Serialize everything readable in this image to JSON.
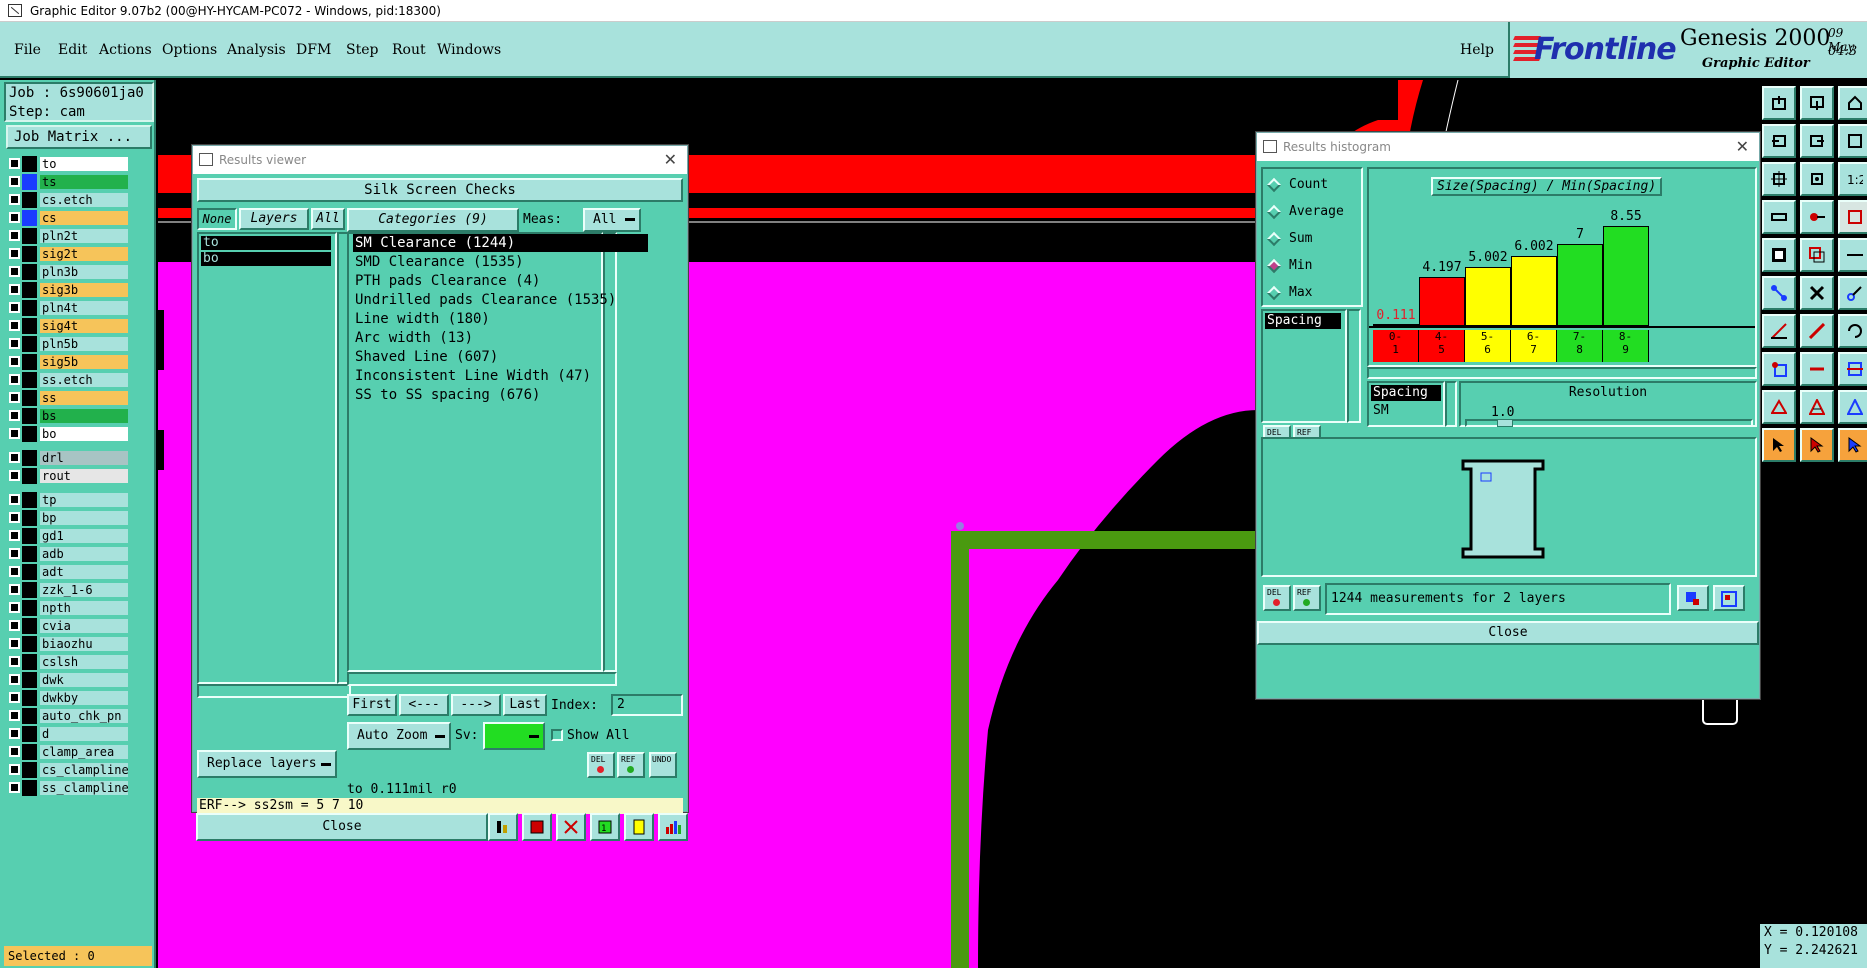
{
  "window_title": "Graphic Editor 9.07b2 (00@HY-HYCAM-PC072 - Windows, pid:18300)",
  "menu": {
    "items": [
      "File",
      "Edit",
      "Actions",
      "Options",
      "Analysis",
      "DFM",
      "Step",
      "Rout",
      "Windows"
    ],
    "help": "Help"
  },
  "logo": {
    "brand": "Frontline",
    "product": "Genesis 2000",
    "subtitle": "Graphic Editor",
    "date_line1": "09 May",
    "date_line2": "04:3"
  },
  "job": {
    "job_line": "Job : 6s90601ja0",
    "step_line": "Step: cam",
    "matrix_button": "Job Matrix ..."
  },
  "layers": [
    {
      "name": "to",
      "color": "#ffffff",
      "swatch": "#000000"
    },
    {
      "name": "ts",
      "color": "#22b14c",
      "swatch": "#1a3cff"
    },
    {
      "name": "cs.etch",
      "color": "#a8e2dc",
      "swatch": "#000000"
    },
    {
      "name": "cs",
      "color": "#f6c45a",
      "swatch": "#1a3cff"
    },
    {
      "name": "pln2t",
      "color": "#a8e2dc",
      "swatch": "#000000"
    },
    {
      "name": "sig2t",
      "color": "#f6c45a",
      "swatch": "#000000"
    },
    {
      "name": "pln3b",
      "color": "#a8e2dc",
      "swatch": "#000000"
    },
    {
      "name": "sig3b",
      "color": "#f6c45a",
      "swatch": "#000000"
    },
    {
      "name": "pln4t",
      "color": "#a8e2dc",
      "swatch": "#000000"
    },
    {
      "name": "sig4t",
      "color": "#f6c45a",
      "swatch": "#000000"
    },
    {
      "name": "pln5b",
      "color": "#a8e2dc",
      "swatch": "#000000"
    },
    {
      "name": "sig5b",
      "color": "#f6c45a",
      "swatch": "#000000"
    },
    {
      "name": "ss.etch",
      "color": "#a8e2dc",
      "swatch": "#000000"
    },
    {
      "name": "ss",
      "color": "#f6c45a",
      "swatch": "#000000"
    },
    {
      "name": "bs",
      "color": "#22b14c",
      "swatch": "#000000"
    },
    {
      "name": "bo",
      "color": "#ffffff",
      "swatch": "#000000"
    },
    {
      "name": "drl",
      "color": "#a8c4c4",
      "swatch": "#000000"
    },
    {
      "name": "rout",
      "color": "#e6e6e6",
      "swatch": "#000000"
    },
    {
      "name": "tp",
      "color": "#a8e2dc",
      "swatch": "#000000"
    },
    {
      "name": "bp",
      "color": "#a8e2dc",
      "swatch": "#000000"
    },
    {
      "name": "gd1",
      "color": "#a8e2dc",
      "swatch": "#000000"
    },
    {
      "name": "adb",
      "color": "#a8e2dc",
      "swatch": "#000000"
    },
    {
      "name": "adt",
      "color": "#a8e2dc",
      "swatch": "#000000"
    },
    {
      "name": "zzk_1-6",
      "color": "#a8e2dc",
      "swatch": "#000000"
    },
    {
      "name": "npth",
      "color": "#a8e2dc",
      "swatch": "#000000"
    },
    {
      "name": "cvia",
      "color": "#a8e2dc",
      "swatch": "#000000"
    },
    {
      "name": "biaozhu",
      "color": "#a8e2dc",
      "swatch": "#000000"
    },
    {
      "name": "cslsh",
      "color": "#a8e2dc",
      "swatch": "#000000"
    },
    {
      "name": "dwk",
      "color": "#a8e2dc",
      "swatch": "#000000"
    },
    {
      "name": "dwkby",
      "color": "#a8e2dc",
      "swatch": "#000000"
    },
    {
      "name": "auto_chk_pn",
      "color": "#a8e2dc",
      "swatch": "#000000"
    },
    {
      "name": "d",
      "color": "#a8e2dc",
      "swatch": "#000000"
    },
    {
      "name": "clamp_area",
      "color": "#a8e2dc",
      "swatch": "#000000"
    },
    {
      "name": "cs_clampline",
      "color": "#a8e2dc",
      "swatch": "#000000"
    },
    {
      "name": "ss_clampline",
      "color": "#a8e2dc",
      "swatch": "#000000"
    }
  ],
  "selected_text": "Selected : 0",
  "coords": {
    "x": "X = 0.120108",
    "y": "Y = 2.242621"
  },
  "results_viewer": {
    "title": "Results viewer",
    "header": "Silk Screen Checks",
    "none_btn": "None",
    "layers_btn": "Layers",
    "all_btn": "All",
    "layer_items": [
      "to",
      "bo"
    ],
    "categories_btn": "Categories (9)",
    "meas_label": "Meas:",
    "meas_value": "All",
    "categories": [
      "SM Clearance (1244)",
      "SMD Clearance (1535)",
      "PTH pads Clearance (4)",
      "Undrilled pads Clearance (1535)",
      "Line width (180)",
      "Arc width (13)",
      "Shaved Line (607)",
      "Inconsistent Line Width (47)",
      "SS to SS spacing (676)"
    ],
    "first_btn": "First",
    "prev_btn": "<---",
    "next_btn": "--->",
    "last_btn": "Last",
    "index_label": "Index:",
    "index_value": "2",
    "zoom_value": "Auto Zoom",
    "sv_label": "Sv:",
    "show_all": "Show All",
    "replace_value": "Replace layers",
    "status_line": "to 0.111mil   r0",
    "erf_line": "ERF--> ss2sm = 5 7 10",
    "close_btn": "Close",
    "del_label": "DEL",
    "ref_label": "REF",
    "undo_label": "UNDO"
  },
  "results_histogram": {
    "title": "Results histogram",
    "options": [
      "Count",
      "Average",
      "Sum",
      "Min",
      "Max"
    ],
    "selected_option": "Min",
    "chart_title": "Size(Spacing) / Min(Spacing)",
    "measure_list": [
      "Spacing"
    ],
    "bottom_list": [
      "Spacing",
      "SM"
    ],
    "resolution_label": "Resolution",
    "resolution_value": "1.0",
    "measurements": "1244 measurements for 2 layers",
    "close_btn": "Close",
    "del_label": "DEL",
    "ref_label": "REF"
  },
  "chart_data": {
    "type": "bar",
    "title": "Size(Spacing) / Min(Spacing)",
    "categories": [
      "0-1",
      "4-5",
      "5-6",
      "6-7",
      "7-8",
      "8-9"
    ],
    "values": [
      0.111,
      4.197,
      5.002,
      6.002,
      7,
      8.55
    ],
    "value_labels": [
      "0.111",
      "4.197",
      "5.002",
      "6.002",
      "7",
      "8.55"
    ],
    "colors": [
      "#ff0000",
      "#ff0000",
      "#ffff00",
      "#ffff00",
      "#22dd22",
      "#22dd22"
    ],
    "ylim": [
      0,
      8.55
    ]
  },
  "colors": {
    "panel": "#57cfb0",
    "panel_light": "#a8e2dc",
    "magenta": "#ff00ff",
    "red": "#ff0000",
    "green_track": "#4a9a10"
  }
}
